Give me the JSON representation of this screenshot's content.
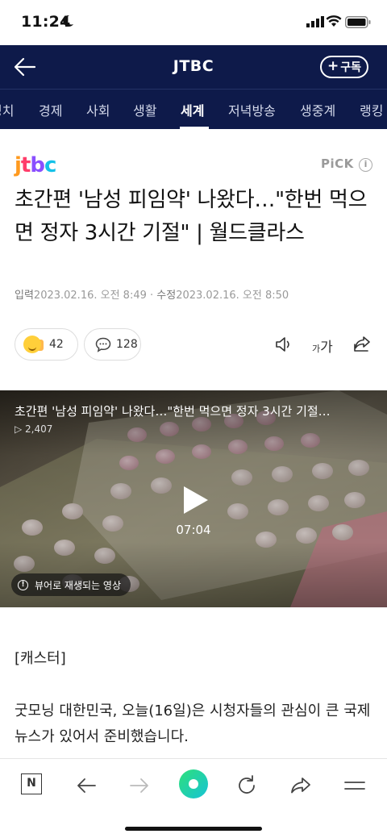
{
  "status_bar": {
    "time": "11:24"
  },
  "header": {
    "brand": "JTBC",
    "subscribe_label": "구독"
  },
  "tabs": [
    {
      "label": "정치"
    },
    {
      "label": "경제"
    },
    {
      "label": "사회"
    },
    {
      "label": "생활"
    },
    {
      "label": "세계"
    },
    {
      "label": "저녁방송"
    },
    {
      "label": "생중계"
    },
    {
      "label": "랭킹"
    }
  ],
  "article": {
    "logo_letters": [
      "j",
      "t",
      "b",
      "c"
    ],
    "pick_label": "PiCK",
    "title": "초간편 '남성 피임약' 나왔다…\"한번 먹으면 정자 3시간 기절\" | 월드클라스",
    "input_label": "입력",
    "input_date": "2023.02.16. 오전 8:49",
    "edit_label": "수정",
    "edit_date": "2023.02.16. 오전 8:50",
    "reaction_count": "42",
    "comment_count": "128",
    "font_size_label": "가"
  },
  "video": {
    "title": "초간편 '남성 피임약' 나왔다…\"한번 먹으면 정자 3시간 기절…",
    "views": "2,407",
    "duration": "07:04",
    "note": "뷰어로 재생되는 영상"
  },
  "body": {
    "caster": "[캐스터]",
    "paragraph": "굿모닝 대한민국, 오늘(16일)은 시청자들의 관심이 큰 국제 뉴스가 있어서 준비했습니다."
  },
  "toolbar": {
    "n_label": "N"
  },
  "colors": {
    "header_bg": "#0e1a4a",
    "logo_j": "#ff9a1f",
    "logo_t": "#ff3d6a",
    "logo_b": "#8a4fff",
    "logo_c": "#14c1e8"
  }
}
